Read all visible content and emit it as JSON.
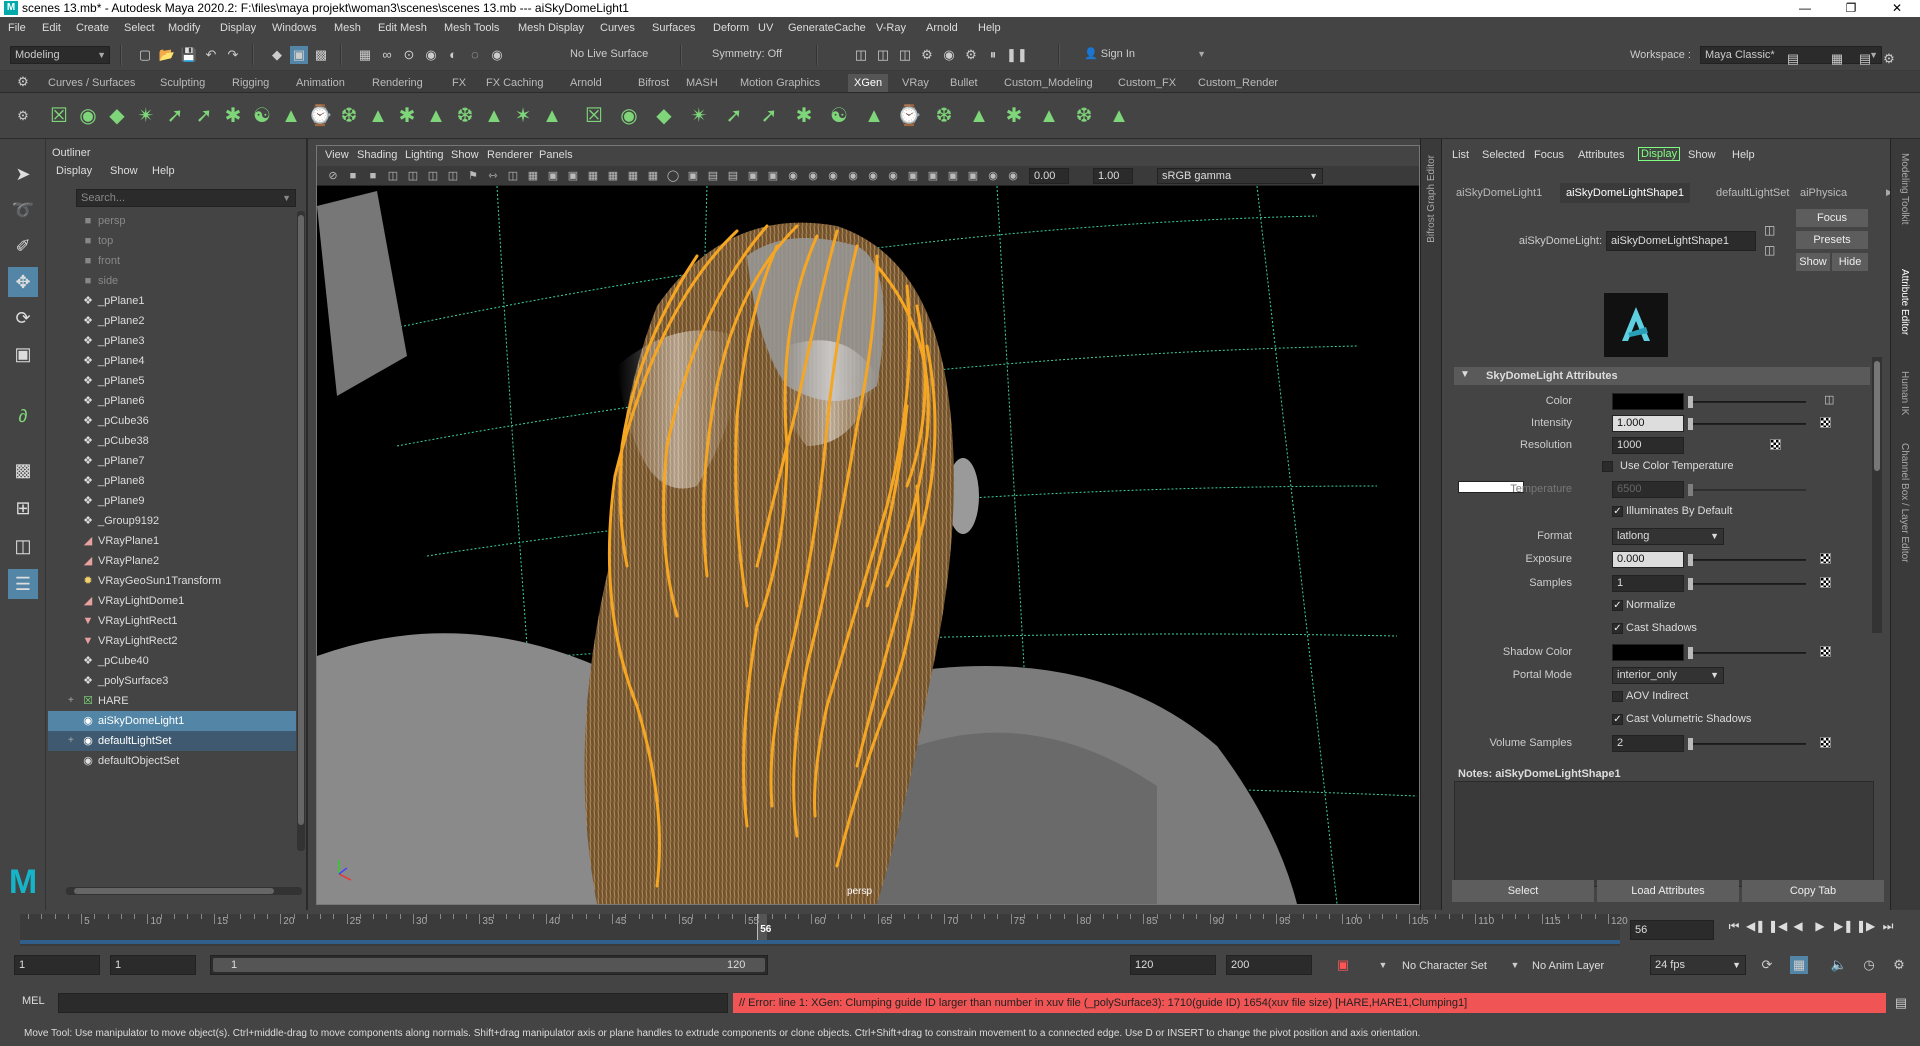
{
  "titlebar": {
    "title": "scenes 13.mb* - Autodesk Maya 2020.2: F:\\files\\maya projekt\\woman3\\scenes\\scenes 13.mb   ---   aiSkyDomeLight1"
  },
  "menus": [
    "File",
    "Edit",
    "Create",
    "Select",
    "Modify",
    "Display",
    "Windows",
    "Mesh",
    "Edit Mesh",
    "Mesh Tools",
    "Mesh Display",
    "Curves",
    "Surfaces",
    "Deform",
    "UV",
    "Generate",
    "Cache",
    "V-Ray",
    "Arnold",
    "Help"
  ],
  "status": {
    "mode": "Modeling",
    "live_surface": "No Live Surface",
    "symmetry": "Symmetry: Off",
    "sign_in": "Sign In",
    "workspace_label": "Workspace :",
    "workspace": "Maya Classic*"
  },
  "shelf_tabs": [
    "Curves / Surfaces",
    "Sculpting",
    "Rigging",
    "Animation",
    "Rendering",
    "FX",
    "FX Caching",
    "Arnold",
    "Bifrost",
    "MASH",
    "Motion Graphics",
    "XGen",
    "VRay",
    "Bullet",
    "Custom_Modeling",
    "Custom_FX",
    "Custom_Render"
  ],
  "shelf_active": "XGen",
  "outliner": {
    "title": "Outliner",
    "menu": [
      "Display",
      "Show",
      "Help"
    ],
    "search_placeholder": "Search...",
    "items": [
      {
        "label": "persp",
        "icon": "camera-icon",
        "state": "dim"
      },
      {
        "label": "top",
        "icon": "camera-icon",
        "state": "dim"
      },
      {
        "label": "front",
        "icon": "camera-icon",
        "state": "dim"
      },
      {
        "label": "side",
        "icon": "camera-icon",
        "state": "dim"
      },
      {
        "label": "_pPlane1",
        "icon": "transform-icon",
        "state": ""
      },
      {
        "label": "_pPlane2",
        "icon": "transform-icon",
        "state": ""
      },
      {
        "label": "_pPlane3",
        "icon": "transform-icon",
        "state": ""
      },
      {
        "label": "_pPlane4",
        "icon": "transform-icon",
        "state": ""
      },
      {
        "label": "_pPlane5",
        "icon": "transform-icon",
        "state": ""
      },
      {
        "label": "_pPlane6",
        "icon": "transform-icon",
        "state": ""
      },
      {
        "label": "_pCube36",
        "icon": "transform-icon",
        "state": ""
      },
      {
        "label": "_pCube38",
        "icon": "transform-icon",
        "state": ""
      },
      {
        "label": "_pPlane7",
        "icon": "transform-icon",
        "state": ""
      },
      {
        "label": "_pPlane8",
        "icon": "transform-icon",
        "state": ""
      },
      {
        "label": "_pPlane9",
        "icon": "transform-icon",
        "state": ""
      },
      {
        "label": "_Group9192",
        "icon": "transform-icon",
        "state": ""
      },
      {
        "label": "VRayPlane1",
        "icon": "vray-plane-icon",
        "state": ""
      },
      {
        "label": "VRayPlane2",
        "icon": "vray-plane-icon",
        "state": ""
      },
      {
        "label": "VRayGeoSun1Transform",
        "icon": "sun-icon",
        "state": ""
      },
      {
        "label": "VRayLightDome1",
        "icon": "vray-plane-icon",
        "state": ""
      },
      {
        "label": "VRayLightRect1",
        "icon": "rect-light-icon",
        "state": ""
      },
      {
        "label": "VRayLightRect2",
        "icon": "rect-light-icon",
        "state": ""
      },
      {
        "label": "_pCube40",
        "icon": "transform-icon",
        "state": ""
      },
      {
        "label": "_polySurface3",
        "icon": "transform-icon",
        "state": ""
      },
      {
        "label": "HARE",
        "icon": "xgen-icon",
        "state": "",
        "expand": "+"
      },
      {
        "label": "aiSkyDomeLight1",
        "icon": "dome-light-icon",
        "state": "sel"
      },
      {
        "label": "defaultLightSet",
        "icon": "set-icon",
        "state": "hl",
        "expand": "+"
      },
      {
        "label": "defaultObjectSet",
        "icon": "set-icon",
        "state": ""
      }
    ]
  },
  "viewport": {
    "menu": [
      "View",
      "Shading",
      "Lighting",
      "Show",
      "Renderer",
      "Panels"
    ],
    "exposure": "0.00",
    "gamma": "1.00",
    "color_space": "sRGB gamma",
    "camera_label": "persp"
  },
  "side_tabs_left": [
    "Bifrost Graph Editor"
  ],
  "side_tabs_right": [
    "Modeling Toolkit",
    "Attribute Editor",
    "Human IK",
    "Channel Box / Layer Editor"
  ],
  "attribute_editor": {
    "menu": [
      "List",
      "Selected",
      "Focus",
      "Attributes",
      "Display",
      "Show",
      "Help"
    ],
    "menu_active": "Display",
    "tabs": [
      "aiSkyDomeLight1",
      "aiSkyDomeLightShape1",
      "defaultLightSet",
      "aiPhysica"
    ],
    "tab_active": "aiSkyDomeLightShape1",
    "node_label": "aiSkyDomeLight:",
    "node_name": "aiSkyDomeLightShape1",
    "focus_btn": "Focus",
    "presets_btn": "Presets",
    "show_btn": "Show",
    "hide_btn": "Hide",
    "section": "SkyDomeLight Attributes",
    "attrs": {
      "color_label": "Color",
      "intensity_label": "Intensity",
      "intensity": "1.000",
      "resolution_label": "Resolution",
      "resolution": "1000",
      "use_color_temp": "Use Color Temperature",
      "temperature_label": "Temperature",
      "temperature": "6500",
      "illuminates": "Illuminates By Default",
      "format_label": "Format",
      "format": "latlong",
      "exposure_label": "Exposure",
      "exposure": "0.000",
      "samples_label": "Samples",
      "samples": "1",
      "normalize": "Normalize",
      "cast_shadows": "Cast Shadows",
      "shadow_color_label": "Shadow Color",
      "portal_label": "Portal Mode",
      "portal": "interior_only",
      "aov_indirect": "AOV Indirect",
      "cast_vol_shadows": "Cast Volumetric Shadows",
      "vol_samples_label": "Volume Samples",
      "vol_samples": "2"
    },
    "notes_label": "Notes:  aiSkyDomeLightShape1",
    "bottom_buttons": [
      "Select",
      "Load Attributes",
      "Copy Tab"
    ]
  },
  "timeline": {
    "ticks": [
      5,
      10,
      15,
      20,
      25,
      30,
      35,
      40,
      45,
      50,
      55,
      60,
      65,
      70,
      75,
      80,
      85,
      90,
      95,
      100,
      105,
      110,
      115,
      120
    ],
    "current": "56",
    "current_frame_field": "56"
  },
  "range": {
    "start": "1",
    "start2": "1",
    "slider_start": "1",
    "slider_end": "120",
    "end": "120",
    "end2": "200",
    "character_set": "No Character Set",
    "anim_layer": "No Anim Layer",
    "fps": "24 fps"
  },
  "command": {
    "lang": "MEL",
    "error": "// Error: line 1: XGen:  Clumping guide ID larger than number in xuv file (_polySurface3): 1710(guide ID) 1654(xuv file size) [HARE,HARE1,Clumping1]"
  },
  "help_line": "Move Tool: Use manipulator to move object(s). Ctrl+middle-drag to move components along normals. Shift+drag manipulator axis or plane handles to extrude components or clone objects. Ctrl+Shift+drag to constrain movement to a connected edge. Use D or INSERT to change the pivot position and axis orientation.",
  "colors": {
    "selection": "#5285a6",
    "error": "#f05454",
    "hair_guides": "#f5a623",
    "hair": "#8a6a3e",
    "grid": "#3fd0a0"
  }
}
